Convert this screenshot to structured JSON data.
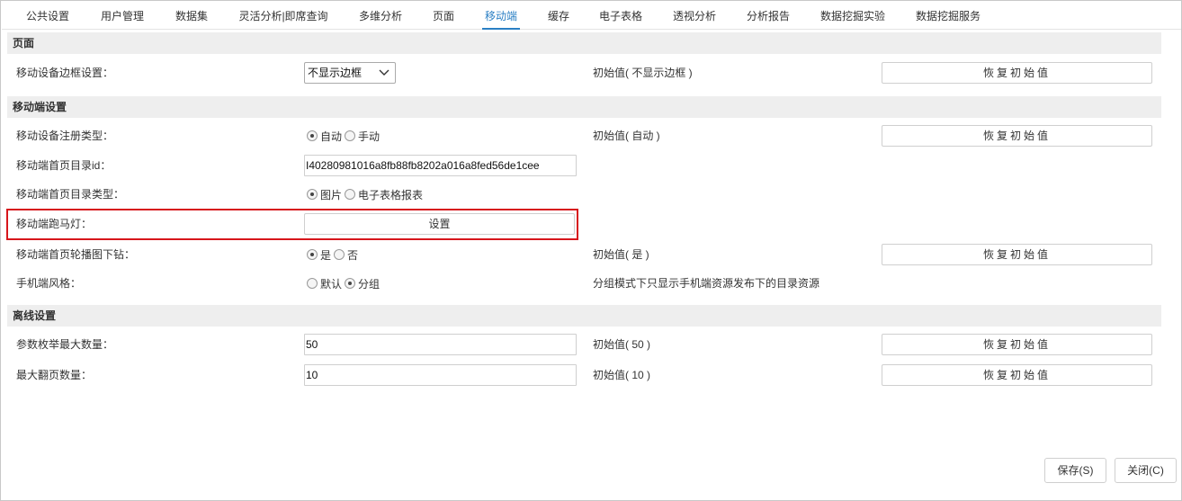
{
  "tabs": [
    {
      "label": "公共设置"
    },
    {
      "label": "用户管理"
    },
    {
      "label": "数据集"
    },
    {
      "label": "灵活分析|即席查询"
    },
    {
      "label": "多维分析"
    },
    {
      "label": "页面"
    },
    {
      "label": "移动端"
    },
    {
      "label": "缓存"
    },
    {
      "label": "电子表格"
    },
    {
      "label": "透视分析"
    },
    {
      "label": "分析报告"
    },
    {
      "label": "数据挖掘实验"
    },
    {
      "label": "数据挖掘服务"
    }
  ],
  "active_tab": "移动端",
  "accent_color": "#2a7fc4",
  "highlight_color": "#d7161c",
  "sections": {
    "page": "页面",
    "mobile": "移动端设置",
    "offline": "离线设置"
  },
  "restore_label": "恢复初始值",
  "rows": {
    "border": {
      "label": "移动设备边框设置：",
      "select_value": "不显示边框",
      "initial": "初始值( 不显示边框 )"
    },
    "reg_type": {
      "label": "移动设备注册类型：",
      "options": [
        "自动",
        "手动"
      ],
      "selected": "自动",
      "initial": "初始值( 自动 )"
    },
    "home_dir_id": {
      "label": "移动端首页目录id：",
      "value": "I40280981016a8fb88fb8202a016a8fed56de1cee"
    },
    "home_dir_type": {
      "label": "移动端首页目录类型：",
      "options": [
        "图片",
        "电子表格报表"
      ],
      "selected": "图片"
    },
    "marquee": {
      "label": "移动端跑马灯：",
      "button": "设置"
    },
    "carousel": {
      "label": "移动端首页轮播图下钻：",
      "options": [
        "是",
        "否"
      ],
      "selected": "是",
      "initial": "初始值( 是 )"
    },
    "style": {
      "label": "手机端风格：",
      "options": [
        "默认",
        "分组"
      ],
      "selected": "分组",
      "note": "分组模式下只显示手机端资源发布下的目录资源"
    },
    "param_max": {
      "label": "参数枚举最大数量：",
      "value": "50",
      "initial": "初始值( 50 )"
    },
    "max_pages": {
      "label": "最大翻页数量：",
      "value": "10",
      "initial": "初始值( 10 )"
    }
  },
  "footer": {
    "save": "保存(S)",
    "close": "关闭(C)"
  }
}
